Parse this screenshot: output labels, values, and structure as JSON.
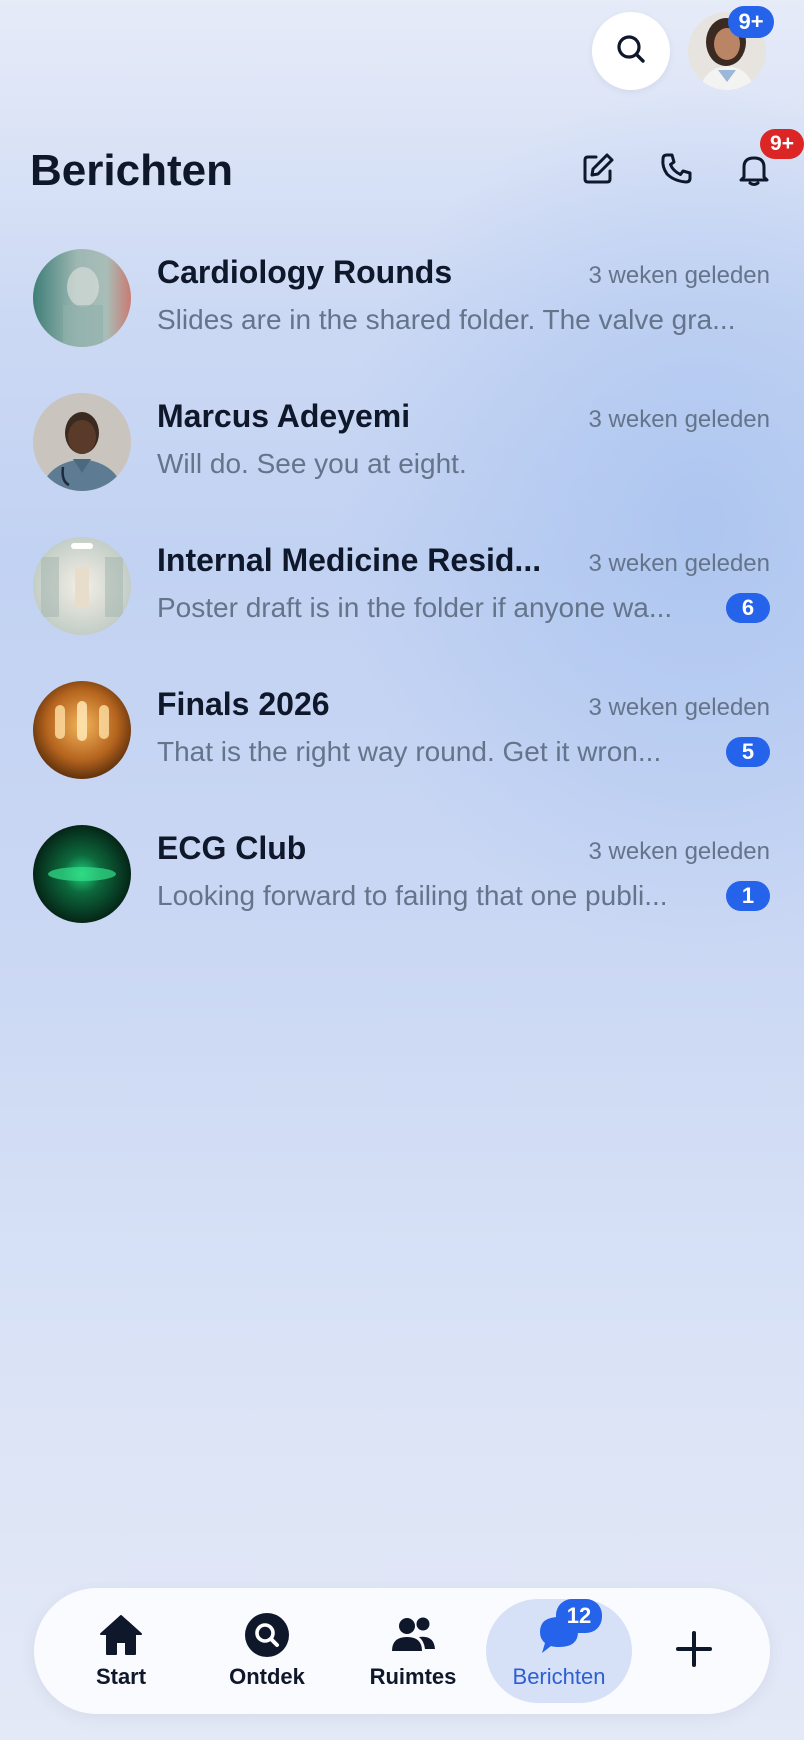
{
  "top": {
    "profile_badge": "9+"
  },
  "header": {
    "title": "Berichten",
    "notification_badge": "9+"
  },
  "chats": [
    {
      "name": "Cardiology Rounds",
      "time": "3 weken geleden",
      "preview": "Slides are in the shared folder. The valve gra...",
      "unread": "",
      "avatar": "blurred-teal-group-photo"
    },
    {
      "name": "Marcus Adeyemi",
      "time": "3 weken geleden",
      "preview": "Will do. See you at eight.",
      "unread": "",
      "avatar": "doctor-portrait"
    },
    {
      "name": "Internal Medicine Resid...",
      "time": "3 weken geleden",
      "preview": "Poster draft is in the folder if anyone wa...",
      "unread": "6",
      "avatar": "hospital-corridor"
    },
    {
      "name": "Finals 2026",
      "time": "3 weken geleden",
      "preview": "That is the right way round. Get it wron...",
      "unread": "5",
      "avatar": "warm-bokeh-lights"
    },
    {
      "name": "ECG Club",
      "time": "3 weken geleden",
      "preview": "Looking forward to failing that one publi...",
      "unread": "1",
      "avatar": "green-ecg-glow"
    }
  ],
  "nav": {
    "items": [
      {
        "label": "Start",
        "icon": "home-icon"
      },
      {
        "label": "Ontdek",
        "icon": "discover-icon"
      },
      {
        "label": "Ruimtes",
        "icon": "people-icon"
      },
      {
        "label": "Berichten",
        "icon": "chat-bubble-icon",
        "badge": "12",
        "active": true
      }
    ],
    "plus_icon": "plus-icon"
  },
  "colors": {
    "accent": "#2563eb",
    "alert": "#dc2626",
    "text_primary": "#0f172a",
    "text_secondary": "#64748b",
    "active_nav_bg": "#d6e1f8"
  }
}
